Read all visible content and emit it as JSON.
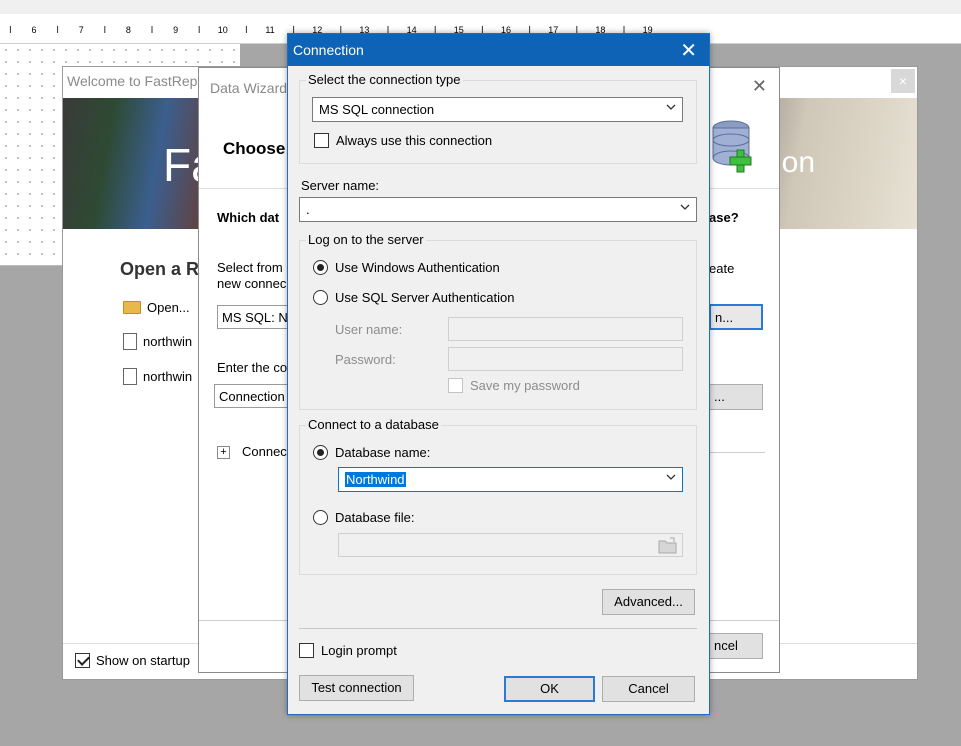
{
  "ruler": {
    "numbers": [
      "6",
      "7",
      "8",
      "9",
      "10",
      "11",
      "12",
      "13",
      "14",
      "15",
      "16",
      "17",
      "18",
      "19"
    ]
  },
  "welcome": {
    "title": "Welcome to FastRep",
    "close": "×",
    "banner_text": "Fa",
    "banner_text_right": "ion",
    "open_recent": "Open a R",
    "items": [
      {
        "label": "Open...",
        "icon": "folder-icon"
      },
      {
        "label": "northwin",
        "icon": "file-icon"
      },
      {
        "label": "northwin",
        "icon": "file-icon"
      }
    ],
    "show_on_startup": "Show on startup",
    "show_on_startup_checked": true
  },
  "wizard": {
    "title": "Data Wizard",
    "close": "✕",
    "heading": "Choose",
    "question": "Which dat",
    "question_right": "ase?",
    "select_from": "Select from",
    "select_from_line2": "new connec",
    "create_text": "eate",
    "connection_value": "MS SQL: No",
    "new_button": "n...",
    "enter_label": "Enter the co",
    "connstring_value": "Connection",
    "edit_button": "...",
    "plus": "+",
    "connection_label": "Connec",
    "cancel_button": "ncel"
  },
  "connection": {
    "title": "Connection",
    "close": "✕",
    "type_group_label": "Select the connection type",
    "type_value": "MS SQL connection",
    "always_use": "Always use this connection",
    "always_use_checked": false,
    "server_label": "Server name:",
    "server_value": ".",
    "logon_group_label": "Log on to the server",
    "windows_auth": "Use Windows Authentication",
    "sql_auth": "Use SQL Server Authentication",
    "auth_selected": "windows",
    "user_name_label": "User name:",
    "password_label": "Password:",
    "user_name_value": "",
    "password_value": "",
    "save_password": "Save my password",
    "db_group_label": "Connect to a database",
    "db_name_radio": "Database name:",
    "db_name_value": "Northwind",
    "db_file_radio": "Database file:",
    "db_file_value": "",
    "db_selected": "name",
    "advanced_button": "Advanced...",
    "login_prompt": "Login prompt",
    "login_prompt_checked": false,
    "test_button": "Test connection",
    "ok_button": "OK",
    "cancel_button": "Cancel"
  },
  "colors": {
    "titlebar": "#0f63b7",
    "selection": "#0078d7",
    "focus_border": "#2d7ad6"
  }
}
